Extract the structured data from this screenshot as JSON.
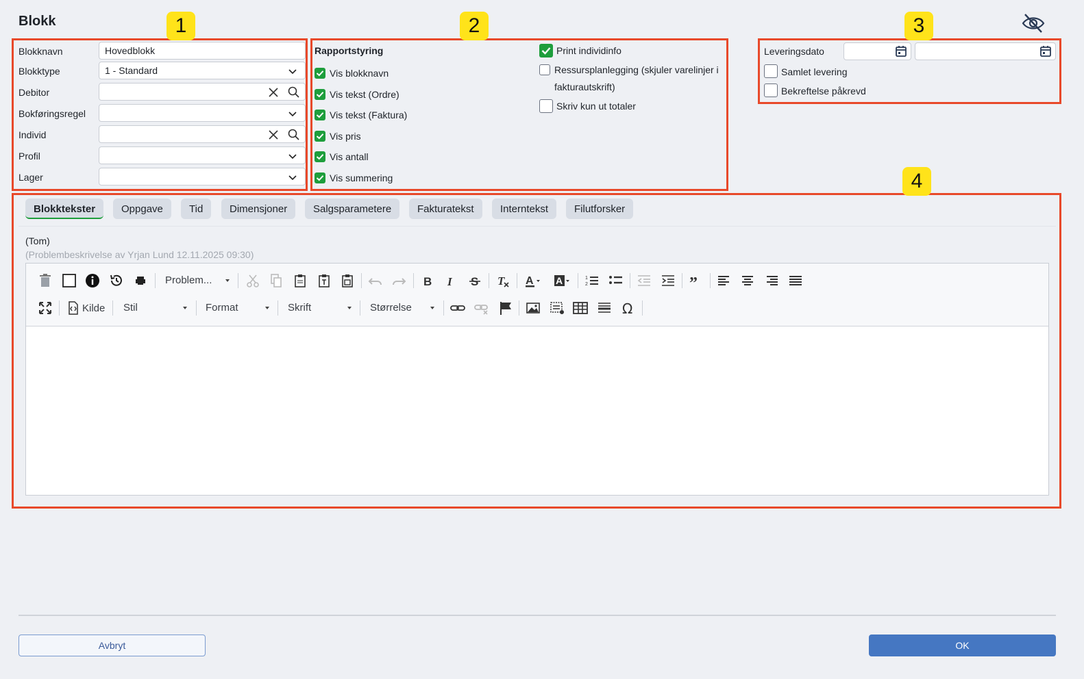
{
  "title": "Blokk",
  "callouts": [
    "1",
    "2",
    "3",
    "4"
  ],
  "section1": {
    "fields": [
      {
        "label": "Blokknavn",
        "value": "Hovedblokk",
        "kind": "text"
      },
      {
        "label": "Blokktype",
        "value": "1 - Standard",
        "kind": "select"
      },
      {
        "label": "Debitor",
        "value": "",
        "kind": "lookup"
      },
      {
        "label": "Bokføringsregel",
        "value": "",
        "kind": "select"
      },
      {
        "label": "Individ",
        "value": "",
        "kind": "lookup"
      },
      {
        "label": "Profil",
        "value": "",
        "kind": "select"
      },
      {
        "label": "Lager",
        "value": "",
        "kind": "select"
      }
    ]
  },
  "section2": {
    "heading": "Rapportstyring",
    "left_checks": [
      {
        "label": "Vis blokknavn",
        "checked": true
      },
      {
        "label": "Vis tekst (Ordre)",
        "checked": true
      },
      {
        "label": "Vis tekst (Faktura)",
        "checked": true
      },
      {
        "label": "Vis pris",
        "checked": true
      },
      {
        "label": "Vis antall",
        "checked": true
      },
      {
        "label": "Vis summering",
        "checked": true
      }
    ],
    "right_checks": [
      {
        "label": "Print individinfo",
        "checked": true
      },
      {
        "label": "Ressursplanlegging (skjuler varelinjer i",
        "label2": "fakturautskrift)",
        "checked": false
      },
      {
        "label": "Skriv kun ut totaler",
        "checked": false
      }
    ]
  },
  "section3": {
    "delivery_label": "Leveringsdato",
    "date_from": "",
    "date_to": "",
    "checks": [
      {
        "label": "Samlet levering",
        "checked": false
      },
      {
        "label": "Bekreftelse påkrevd",
        "checked": false
      }
    ]
  },
  "tabs": [
    "Blokktekster",
    "Oppgave",
    "Tid",
    "Dimensjoner",
    "Salgsparametere",
    "Fakturatekst",
    "Interntekst",
    "Filutforsker"
  ],
  "active_tab": "Blokktekster",
  "editor": {
    "status": "(Tom)",
    "hint": "(Problembeskrivelse av Yrjan Lund 12.11.2025 09:30)",
    "template_combo": "Problem...",
    "source_label": "Kilde",
    "style_combo": "Stil",
    "format_combo": "Format",
    "font_combo": "Skrift",
    "size_combo": "Størrelse"
  },
  "footer": {
    "cancel_label": "Avbryt",
    "ok_label": "OK"
  },
  "colors": {
    "accent": "#4577c2",
    "check_green": "#1e9e3c",
    "callout_box": "#e8492a",
    "callout_fill": "#ffe31a"
  }
}
